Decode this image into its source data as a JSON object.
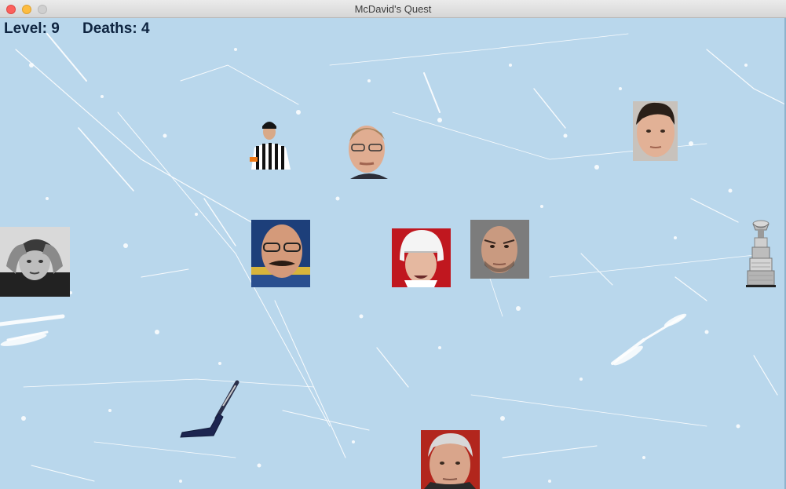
{
  "window": {
    "title": "McDavid's Quest"
  },
  "hud": {
    "level_label": "Level:",
    "level": "9",
    "deaths_label": "Deaths:",
    "deaths": "4"
  },
  "colors": {
    "ice": "#b9d7ec",
    "hud_text": "#0e2440",
    "scratch": "#ffffff"
  },
  "sprites": [
    {
      "name": "player-mcdavid-sprite",
      "depicts": "grayscale portrait player, hands on head"
    },
    {
      "name": "referee-sprite",
      "depicts": "striped referee"
    },
    {
      "name": "coach-glasses-sprite",
      "depicts": "man with glasses"
    },
    {
      "name": "coach-mustache-sprite",
      "depicts": "bald man with glasses and mustache"
    },
    {
      "name": "player-red-helmet-sprite",
      "depicts": "player in white helmet"
    },
    {
      "name": "player-bald-sprite",
      "depicts": "bald player"
    },
    {
      "name": "player-dark-hair-sprite",
      "depicts": "player with dark hair"
    },
    {
      "name": "coach-white-hair-sprite",
      "depicts": "grey-haired man"
    },
    {
      "name": "stanley-cup-icon",
      "depicts": "trophy goal"
    },
    {
      "name": "hockey-stick-icon",
      "depicts": "goalie stick"
    }
  ]
}
